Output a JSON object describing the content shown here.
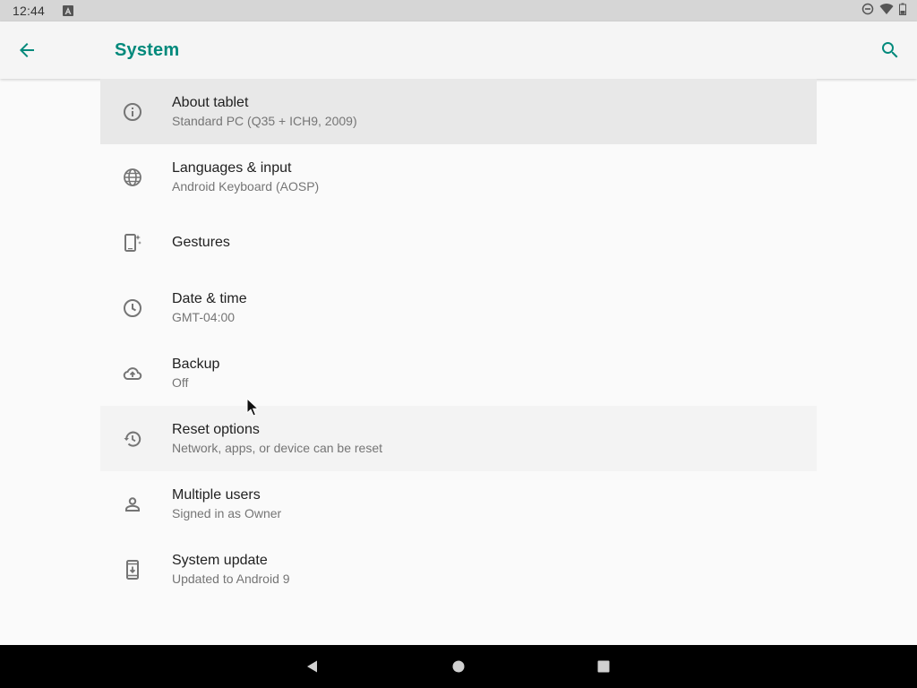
{
  "status_bar": {
    "time": "12:44",
    "icons": [
      "notification-a-icon",
      "dnd-icon",
      "wifi-icon",
      "battery-icon"
    ]
  },
  "app_bar": {
    "title": "System",
    "back_icon": "arrow-back-icon",
    "search_icon": "search-icon"
  },
  "settings": {
    "items": [
      {
        "title": "About tablet",
        "summary": "Standard PC (Q35 + ICH9, 2009)",
        "icon": "info-icon"
      },
      {
        "title": "Languages & input",
        "summary": "Android Keyboard (AOSP)",
        "icon": "globe-icon"
      },
      {
        "title": "Gestures",
        "summary": "",
        "icon": "gestures-phone-icon"
      },
      {
        "title": "Date & time",
        "summary": "GMT-04:00",
        "icon": "clock-icon"
      },
      {
        "title": "Backup",
        "summary": "Off",
        "icon": "cloud-upload-icon"
      },
      {
        "title": "Reset options",
        "summary": "Network, apps, or device can be reset",
        "icon": "history-icon"
      },
      {
        "title": "Multiple users",
        "summary": "Signed in as Owner",
        "icon": "person-icon"
      },
      {
        "title": "System update",
        "summary": "Updated to Android 9",
        "icon": "system-update-icon"
      }
    ]
  },
  "nav_bar": {
    "icons": [
      "back-triangle-icon",
      "home-circle-icon",
      "recents-square-icon"
    ]
  },
  "colors": {
    "accent": "#00897b",
    "icon": "#757575",
    "status_bar": "#d6d6d6",
    "nav_bar": "#000000"
  }
}
